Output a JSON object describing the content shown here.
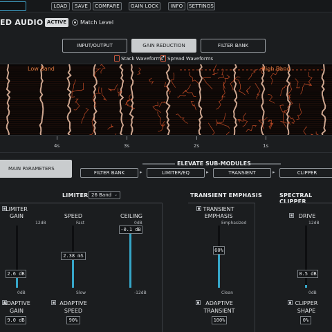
{
  "toolbar": {
    "items": [
      "LOAD",
      "SAVE",
      "COMPARE",
      "GAIN LOCK",
      "INFO",
      "SETTINGS"
    ]
  },
  "header": {
    "brand": "ED AUDIO",
    "active": "ACTIVE",
    "match_level": "Match Level"
  },
  "views": {
    "tabs": [
      "INPUT/OUTPUT",
      "GAIN REDUCTION",
      "FILTER BANK"
    ],
    "selected": "GAIN REDUCTION",
    "stack_waveforms": "Stack Waveforms",
    "spread_waveforms": "Spread Waveforms"
  },
  "spectrogram": {
    "low_band_label": "Low Band",
    "high_band_label": "High Band",
    "time_ticks": [
      "4s",
      "3s",
      "2s",
      "1s"
    ],
    "colors": {
      "trace": "#e0572c",
      "background": "#0a0706"
    }
  },
  "sub_modules": {
    "main_parameters": "MAIN PARAMETERS",
    "title": "ELEVATE SUB-MODULES",
    "chain": [
      "FILTER BANK",
      "LIMITER/EQ",
      "TRANSIENT",
      "CLIPPER"
    ]
  },
  "limiter": {
    "title": "LIMITER",
    "band_select": "26 Band",
    "gain": {
      "label_1": "LIMITER",
      "label_2": "GAIN",
      "top": "12dB",
      "bottom": "0dB",
      "value": "2.6 dB",
      "level": 0.22
    },
    "speed": {
      "label": "SPEED",
      "top": "Fast",
      "bottom": "Slow",
      "value": "2.38 mS",
      "level": 0.45
    },
    "ceiling": {
      "label": "CEILING",
      "top": "0dB",
      "bottom": "-12dB",
      "value": "-0.1 dB",
      "level": 0.99
    },
    "adaptive_gain": {
      "label_1": "ADAPTIVE",
      "label_2": "GAIN",
      "value": "9.0 dB"
    },
    "adaptive_speed": {
      "label_1": "ADAPTIVE",
      "label_2": "SPEED",
      "value": "90%"
    }
  },
  "transient": {
    "title": "TRANSIENT EMPHASIS",
    "emphasis": {
      "label_1": "TRANSIENT",
      "label_2": "EMPHASIS",
      "top": "Emphasized",
      "bottom": "Clean",
      "value": "60%",
      "level": 0.6
    },
    "adaptive": {
      "label_1": "ADAPTIVE",
      "label_2": "TRANSIENT",
      "value": "100%"
    }
  },
  "clipper": {
    "title": "SPECTRAL CLIPPER",
    "drive": {
      "label": "DRIVE",
      "top": "12dB",
      "bottom": "0dB",
      "value": "0.5 dB",
      "level": 0.04
    },
    "shape": {
      "label_1": "CLIPPER",
      "label_2": "SHAPE",
      "value": "0%"
    }
  },
  "accent_color": "#36a6c8"
}
